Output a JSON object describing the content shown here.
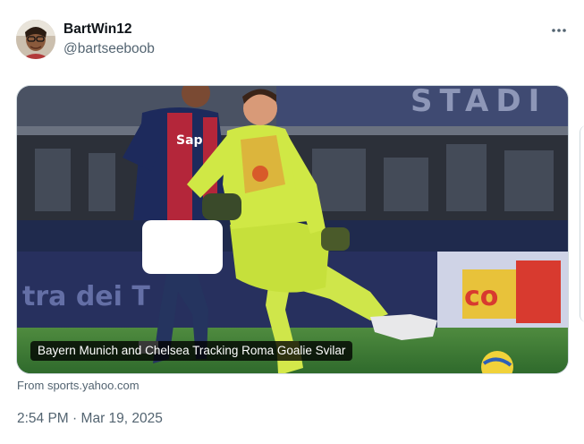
{
  "tweet": {
    "display_name": "BartWin12",
    "handle": "@bartseeboob",
    "more_icon": "more-horizontal-icon",
    "card": {
      "headline": "Bayern Munich and Chelsea Tracking Roma Goalie Svilar",
      "source": "From sports.yahoo.com",
      "image_texts": {
        "stadium_sign": "STADI",
        "ad_board_left": "tra dei T",
        "ad_board_right": "co",
        "shirt_sponsor": "Sap"
      }
    },
    "time": "2:54 PM",
    "separator": "·",
    "date": "Mar 19, 2025"
  },
  "colors": {
    "keeper_kit": "#c9e63a",
    "opponent_kit": "#1d2a5c",
    "pitch": "#3e7a35",
    "muted_text": "#536471"
  }
}
